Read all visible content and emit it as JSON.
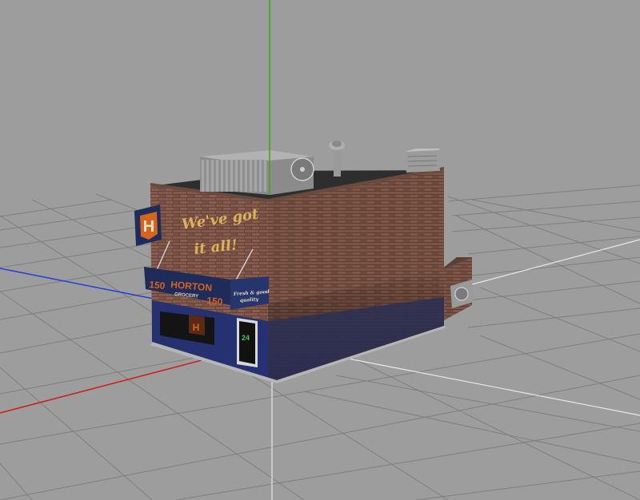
{
  "viewport": {
    "background": "#9d9d9d",
    "grid_color": "#7f7f7f",
    "axes": {
      "x_color": "#d01818",
      "y_color": "#3aa60f",
      "z_color": "#1f3fd8",
      "origin_guide_color": "#e8e8e8"
    }
  },
  "building": {
    "wall_slogan_line1": "We've got",
    "wall_slogan_line2": "it all!",
    "blade_sign_letter": "H",
    "store_name": "HORTON",
    "store_subtitle": "GROCERY",
    "front_number_left": "150",
    "front_number_right": "150",
    "side_sign_line1": "Fresh & good",
    "side_sign_line2": "quality",
    "window_letter": "H",
    "door_sign": "24",
    "colors": {
      "brick": "#7f5547",
      "brick_dark": "#5d3f36",
      "roof": "#2e2e2e",
      "awning": "#1f2c5a",
      "base_band": "#253170",
      "sign_orange": "#d46420",
      "slogan_gold": "#d9b25a"
    }
  },
  "roof_units": {
    "hvac_label": "hvac-unit",
    "vent_label": "roof-vent",
    "box_label": "roof-box"
  }
}
